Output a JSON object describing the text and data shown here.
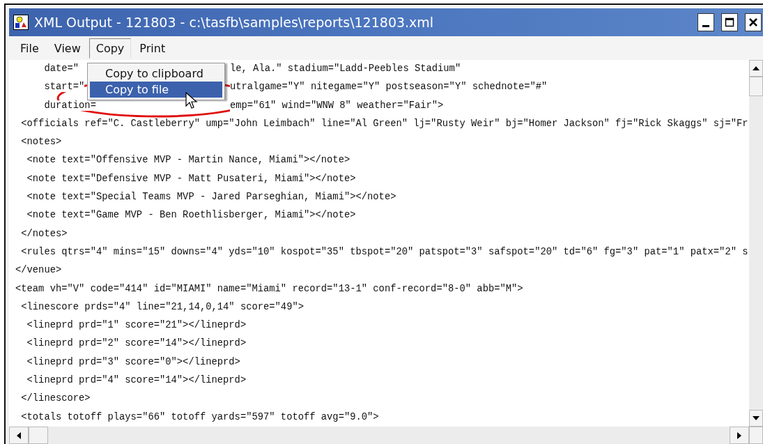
{
  "window": {
    "title": "XML Output - 121803 - c:\\tasfb\\samples\\reports\\121803.xml"
  },
  "menu_bar": [
    {
      "label": "File",
      "selected": false
    },
    {
      "label": "View",
      "selected": false
    },
    {
      "label": "Copy",
      "selected": true
    },
    {
      "label": "Print",
      "selected": false
    }
  ],
  "dropdown": {
    "items": [
      {
        "label": "Copy to clipboard",
        "selected": false
      },
      {
        "label": "Copy to file",
        "selected": true
      }
    ]
  },
  "lines": [
    {
      "left": "     date=\"",
      "right": "le, Ala.\" stadium=\"Ladd-Peebles Stadium\""
    },
    {
      "left": "     start=\"",
      "right": "utralgame=\"Y\" nitegame=\"Y\" postseason=\"Y\" schednote=\"#\""
    },
    {
      "left": "     duration=",
      "right": "emp=\"61\" wind=\"WNW 8\" weather=\"Fair\">"
    },
    {
      "text": " <officials ref=\"C. Castleberry\" ump=\"John Leimbach\" line=\"Al Green\" lj=\"Rusty Weir\" bj=\"Homer Jackson\" fj=\"Rick Skaggs\" sj=\"Fr"
    },
    {
      "text": " <notes>"
    },
    {
      "text": "  <note text=\"Offensive MVP - Martin Nance, Miami\"></note>"
    },
    {
      "text": "  <note text=\"Defensive MVP - Matt Pusateri, Miami\"></note>"
    },
    {
      "text": "  <note text=\"Special Teams MVP - Jared Parseghian, Miami\"></note>"
    },
    {
      "text": "  <note text=\"Game MVP - Ben Roethlisberger, Miami\"></note>"
    },
    {
      "text": " </notes>"
    },
    {
      "text": " <rules qtrs=\"4\" mins=\"15\" downs=\"4\" yds=\"10\" kospot=\"35\" tbspot=\"20\" patspot=\"3\" safspot=\"20\" td=\"6\" fg=\"3\" pat=\"1\" patx=\"2\" s"
    },
    {
      "text": "</venue>"
    },
    {
      "text": "<team vh=\"V\" code=\"414\" id=\"MIAMI\" name=\"Miami\" record=\"13-1\" conf-record=\"8-0\" abb=\"M\">"
    },
    {
      "text": " <linescore prds=\"4\" line=\"21,14,0,14\" score=\"49\">"
    },
    {
      "text": "  <lineprd prd=\"1\" score=\"21\"></lineprd>"
    },
    {
      "text": "  <lineprd prd=\"2\" score=\"14\"></lineprd>"
    },
    {
      "text": "  <lineprd prd=\"3\" score=\"0\"></lineprd>"
    },
    {
      "text": "  <lineprd prd=\"4\" score=\"14\"></lineprd>"
    },
    {
      "text": " </linescore>"
    },
    {
      "text": " <totals totoff plays=\"66\" totoff yards=\"597\" totoff avg=\"9.0\">"
    }
  ]
}
